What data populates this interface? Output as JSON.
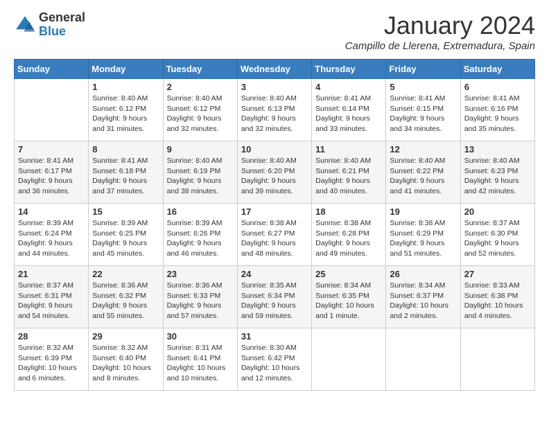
{
  "header": {
    "logo_general": "General",
    "logo_blue": "Blue",
    "month_title": "January 2024",
    "subtitle": "Campillo de Llerena, Extremadura, Spain"
  },
  "columns": [
    "Sunday",
    "Monday",
    "Tuesday",
    "Wednesday",
    "Thursday",
    "Friday",
    "Saturday"
  ],
  "weeks": [
    [
      {
        "day": "",
        "sunrise": "",
        "sunset": "",
        "daylight": ""
      },
      {
        "day": "1",
        "sunrise": "Sunrise: 8:40 AM",
        "sunset": "Sunset: 6:12 PM",
        "daylight": "Daylight: 9 hours and 31 minutes."
      },
      {
        "day": "2",
        "sunrise": "Sunrise: 8:40 AM",
        "sunset": "Sunset: 6:12 PM",
        "daylight": "Daylight: 9 hours and 32 minutes."
      },
      {
        "day": "3",
        "sunrise": "Sunrise: 8:40 AM",
        "sunset": "Sunset: 6:13 PM",
        "daylight": "Daylight: 9 hours and 32 minutes."
      },
      {
        "day": "4",
        "sunrise": "Sunrise: 8:41 AM",
        "sunset": "Sunset: 6:14 PM",
        "daylight": "Daylight: 9 hours and 33 minutes."
      },
      {
        "day": "5",
        "sunrise": "Sunrise: 8:41 AM",
        "sunset": "Sunset: 6:15 PM",
        "daylight": "Daylight: 9 hours and 34 minutes."
      },
      {
        "day": "6",
        "sunrise": "Sunrise: 8:41 AM",
        "sunset": "Sunset: 6:16 PM",
        "daylight": "Daylight: 9 hours and 35 minutes."
      }
    ],
    [
      {
        "day": "7",
        "sunrise": "Sunrise: 8:41 AM",
        "sunset": "Sunset: 6:17 PM",
        "daylight": "Daylight: 9 hours and 36 minutes."
      },
      {
        "day": "8",
        "sunrise": "Sunrise: 8:41 AM",
        "sunset": "Sunset: 6:18 PM",
        "daylight": "Daylight: 9 hours and 37 minutes."
      },
      {
        "day": "9",
        "sunrise": "Sunrise: 8:40 AM",
        "sunset": "Sunset: 6:19 PM",
        "daylight": "Daylight: 9 hours and 38 minutes."
      },
      {
        "day": "10",
        "sunrise": "Sunrise: 8:40 AM",
        "sunset": "Sunset: 6:20 PM",
        "daylight": "Daylight: 9 hours and 39 minutes."
      },
      {
        "day": "11",
        "sunrise": "Sunrise: 8:40 AM",
        "sunset": "Sunset: 6:21 PM",
        "daylight": "Daylight: 9 hours and 40 minutes."
      },
      {
        "day": "12",
        "sunrise": "Sunrise: 8:40 AM",
        "sunset": "Sunset: 6:22 PM",
        "daylight": "Daylight: 9 hours and 41 minutes."
      },
      {
        "day": "13",
        "sunrise": "Sunrise: 8:40 AM",
        "sunset": "Sunset: 6:23 PM",
        "daylight": "Daylight: 9 hours and 42 minutes."
      }
    ],
    [
      {
        "day": "14",
        "sunrise": "Sunrise: 8:39 AM",
        "sunset": "Sunset: 6:24 PM",
        "daylight": "Daylight: 9 hours and 44 minutes."
      },
      {
        "day": "15",
        "sunrise": "Sunrise: 8:39 AM",
        "sunset": "Sunset: 6:25 PM",
        "daylight": "Daylight: 9 hours and 45 minutes."
      },
      {
        "day": "16",
        "sunrise": "Sunrise: 8:39 AM",
        "sunset": "Sunset: 6:26 PM",
        "daylight": "Daylight: 9 hours and 46 minutes."
      },
      {
        "day": "17",
        "sunrise": "Sunrise: 8:38 AM",
        "sunset": "Sunset: 6:27 PM",
        "daylight": "Daylight: 9 hours and 48 minutes."
      },
      {
        "day": "18",
        "sunrise": "Sunrise: 8:38 AM",
        "sunset": "Sunset: 6:28 PM",
        "daylight": "Daylight: 9 hours and 49 minutes."
      },
      {
        "day": "19",
        "sunrise": "Sunrise: 8:38 AM",
        "sunset": "Sunset: 6:29 PM",
        "daylight": "Daylight: 9 hours and 51 minutes."
      },
      {
        "day": "20",
        "sunrise": "Sunrise: 8:37 AM",
        "sunset": "Sunset: 6:30 PM",
        "daylight": "Daylight: 9 hours and 52 minutes."
      }
    ],
    [
      {
        "day": "21",
        "sunrise": "Sunrise: 8:37 AM",
        "sunset": "Sunset: 6:31 PM",
        "daylight": "Daylight: 9 hours and 54 minutes."
      },
      {
        "day": "22",
        "sunrise": "Sunrise: 8:36 AM",
        "sunset": "Sunset: 6:32 PM",
        "daylight": "Daylight: 9 hours and 55 minutes."
      },
      {
        "day": "23",
        "sunrise": "Sunrise: 8:36 AM",
        "sunset": "Sunset: 6:33 PM",
        "daylight": "Daylight: 9 hours and 57 minutes."
      },
      {
        "day": "24",
        "sunrise": "Sunrise: 8:35 AM",
        "sunset": "Sunset: 6:34 PM",
        "daylight": "Daylight: 9 hours and 59 minutes."
      },
      {
        "day": "25",
        "sunrise": "Sunrise: 8:34 AM",
        "sunset": "Sunset: 6:35 PM",
        "daylight": "Daylight: 10 hours and 1 minute."
      },
      {
        "day": "26",
        "sunrise": "Sunrise: 8:34 AM",
        "sunset": "Sunset: 6:37 PM",
        "daylight": "Daylight: 10 hours and 2 minutes."
      },
      {
        "day": "27",
        "sunrise": "Sunrise: 8:33 AM",
        "sunset": "Sunset: 6:38 PM",
        "daylight": "Daylight: 10 hours and 4 minutes."
      }
    ],
    [
      {
        "day": "28",
        "sunrise": "Sunrise: 8:32 AM",
        "sunset": "Sunset: 6:39 PM",
        "daylight": "Daylight: 10 hours and 6 minutes."
      },
      {
        "day": "29",
        "sunrise": "Sunrise: 8:32 AM",
        "sunset": "Sunset: 6:40 PM",
        "daylight": "Daylight: 10 hours and 8 minutes."
      },
      {
        "day": "30",
        "sunrise": "Sunrise: 8:31 AM",
        "sunset": "Sunset: 6:41 PM",
        "daylight": "Daylight: 10 hours and 10 minutes."
      },
      {
        "day": "31",
        "sunrise": "Sunrise: 8:30 AM",
        "sunset": "Sunset: 6:42 PM",
        "daylight": "Daylight: 10 hours and 12 minutes."
      },
      {
        "day": "",
        "sunrise": "",
        "sunset": "",
        "daylight": ""
      },
      {
        "day": "",
        "sunrise": "",
        "sunset": "",
        "daylight": ""
      },
      {
        "day": "",
        "sunrise": "",
        "sunset": "",
        "daylight": ""
      }
    ]
  ]
}
